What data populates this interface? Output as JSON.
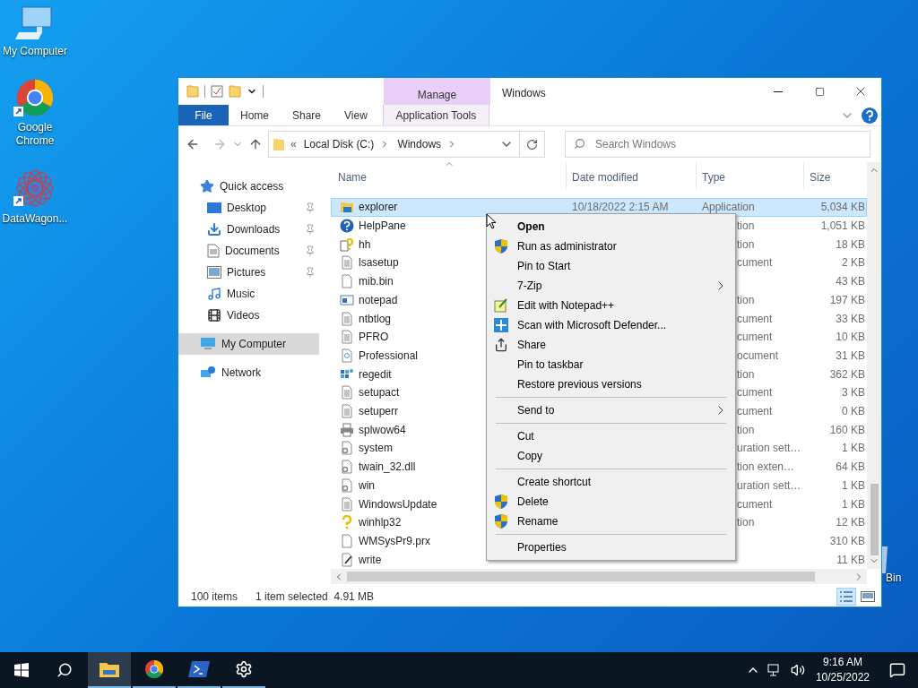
{
  "desktop_icons": [
    {
      "label": "My Computer",
      "shortcut": false
    },
    {
      "label": "Google Chrome",
      "shortcut": true
    },
    {
      "label": "DataWagon...",
      "shortcut": true
    }
  ],
  "recycle_label": "Bin",
  "window": {
    "title": "Windows",
    "contextual_group": "Manage",
    "ribbon_tabs": [
      {
        "label": "File",
        "kind": "file"
      },
      {
        "label": "Home",
        "kind": "plain"
      },
      {
        "label": "Share",
        "kind": "plain"
      },
      {
        "label": "View",
        "kind": "plain"
      },
      {
        "label": "Application Tools",
        "kind": "contextual"
      }
    ],
    "address": {
      "overflow": "«",
      "crumbs": [
        "Local Disk (C:)",
        "Windows"
      ]
    },
    "search": {
      "placeholder": "Search Windows"
    },
    "sidebar": {
      "items": [
        {
          "label": "Quick access",
          "selected": false,
          "children": [
            {
              "label": "Desktop",
              "pinned": true,
              "selected": false
            },
            {
              "label": "Downloads",
              "pinned": true,
              "selected": false
            },
            {
              "label": "Documents",
              "pinned": true,
              "selected": false
            },
            {
              "label": "Pictures",
              "pinned": true,
              "selected": false
            },
            {
              "label": "Music",
              "pinned": false,
              "selected": false
            },
            {
              "label": "Videos",
              "pinned": false,
              "selected": false
            }
          ]
        },
        {
          "label": "My Computer",
          "selected": true
        },
        {
          "label": "Network",
          "selected": false
        }
      ]
    },
    "table": {
      "columns": [
        "Name",
        "Date modified",
        "Type",
        "Size"
      ],
      "rows": [
        {
          "name": "explorer",
          "kind": "app",
          "date": "10/18/2022 2:15 AM",
          "type": "Application",
          "size": "5,034 KB",
          "selected": true,
          "covered": false
        },
        {
          "name": "HelpPane",
          "kind": "help",
          "type": "tion",
          "size": "1,051 KB",
          "selected": false,
          "covered": true
        },
        {
          "name": "hh",
          "kind": "helpdoc",
          "type": "tion",
          "size": "18 KB",
          "selected": false,
          "covered": true
        },
        {
          "name": "lsasetup",
          "kind": "text",
          "type": "cument",
          "size": "2 KB",
          "selected": false,
          "covered": true
        },
        {
          "name": "mib.bin",
          "kind": "blank",
          "size": "43 KB",
          "selected": false
        },
        {
          "name": "notepad",
          "kind": "notepad",
          "type": "tion",
          "size": "197 KB",
          "selected": false,
          "covered": true
        },
        {
          "name": "ntbtlog",
          "kind": "text",
          "type": "cument",
          "size": "33 KB",
          "selected": false,
          "covered": true
        },
        {
          "name": "PFRO",
          "kind": "text",
          "type": "cument",
          "size": "10 KB",
          "selected": false,
          "covered": true
        },
        {
          "name": "Professional",
          "kind": "cert",
          "type": "ocument",
          "size": "31 KB",
          "selected": false,
          "covered": true
        },
        {
          "name": "regedit",
          "kind": "registry",
          "type": "tion",
          "size": "362 KB",
          "selected": false,
          "covered": true
        },
        {
          "name": "setupact",
          "kind": "text",
          "type": "cument",
          "size": "3 KB",
          "selected": false,
          "covered": true
        },
        {
          "name": "setuperr",
          "kind": "text",
          "type": "cument",
          "size": "0 KB",
          "selected": false,
          "covered": true
        },
        {
          "name": "splwow64",
          "kind": "printer",
          "type": "tion",
          "size": "160 KB",
          "selected": false,
          "covered": true
        },
        {
          "name": "system",
          "kind": "config",
          "type": "uration sett…",
          "size": "1 KB",
          "selected": false,
          "covered": true
        },
        {
          "name": "twain_32.dll",
          "kind": "config",
          "type": "tion exten…",
          "size": "64 KB",
          "selected": false,
          "covered": true
        },
        {
          "name": "win",
          "kind": "config",
          "type": "uration sett…",
          "size": "1 KB",
          "selected": false,
          "covered": true
        },
        {
          "name": "WindowsUpdate",
          "kind": "text",
          "type": "cument",
          "size": "1 KB",
          "selected": false,
          "covered": true
        },
        {
          "name": "winhlp32",
          "kind": "question",
          "type": "tion",
          "size": "12 KB",
          "selected": false,
          "covered": true
        },
        {
          "name": "WMSysPr9.prx",
          "kind": "blank",
          "size": "310 KB",
          "selected": false
        },
        {
          "name": "write",
          "kind": "write",
          "size": "11 KB",
          "selected": false
        }
      ]
    },
    "status_bar": {
      "count": "100 items",
      "selection": "1 item selected  4.91 MB"
    },
    "view_buttons": [
      {
        "kind": "details",
        "selected": true
      },
      {
        "kind": "large",
        "selected": false
      }
    ]
  },
  "context_menu": {
    "items": [
      {
        "kind": "item",
        "label": "Open",
        "default": true,
        "submenu": false
      },
      {
        "kind": "item",
        "label": "Run as administrator",
        "default": false,
        "submenu": false
      },
      {
        "kind": "item",
        "label": "Pin to Start",
        "default": false,
        "submenu": false
      },
      {
        "kind": "item",
        "label": "7-Zip",
        "default": false,
        "submenu": true
      },
      {
        "kind": "item",
        "label": "Edit with Notepad++",
        "default": false,
        "submenu": false
      },
      {
        "kind": "item",
        "label": "Scan with Microsoft Defender...",
        "default": false,
        "submenu": false
      },
      {
        "kind": "item",
        "label": "Share",
        "default": false,
        "submenu": false
      },
      {
        "kind": "item",
        "label": "Pin to taskbar",
        "default": false,
        "submenu": false
      },
      {
        "kind": "item",
        "label": "Restore previous versions",
        "default": false,
        "submenu": false
      },
      {
        "kind": "separator"
      },
      {
        "kind": "item",
        "label": "Send to",
        "default": false,
        "submenu": true
      },
      {
        "kind": "separator"
      },
      {
        "kind": "item",
        "label": "Cut",
        "default": false,
        "submenu": false
      },
      {
        "kind": "item",
        "label": "Copy",
        "default": false,
        "submenu": false
      },
      {
        "kind": "separator"
      },
      {
        "kind": "item",
        "label": "Create shortcut",
        "default": false,
        "submenu": false
      },
      {
        "kind": "item",
        "label": "Delete",
        "default": false,
        "submenu": false
      },
      {
        "kind": "item",
        "label": "Rename",
        "default": false,
        "submenu": false
      },
      {
        "kind": "separator"
      },
      {
        "kind": "item",
        "label": "Properties",
        "default": false,
        "submenu": false
      }
    ]
  },
  "taskbar": {
    "apps": [
      {
        "active": true,
        "running": true
      },
      {
        "active": false,
        "running": true
      },
      {
        "active": false,
        "running": true
      },
      {
        "active": false,
        "running": true
      }
    ],
    "time": "9:16 AM",
    "date": "10/25/2022"
  }
}
